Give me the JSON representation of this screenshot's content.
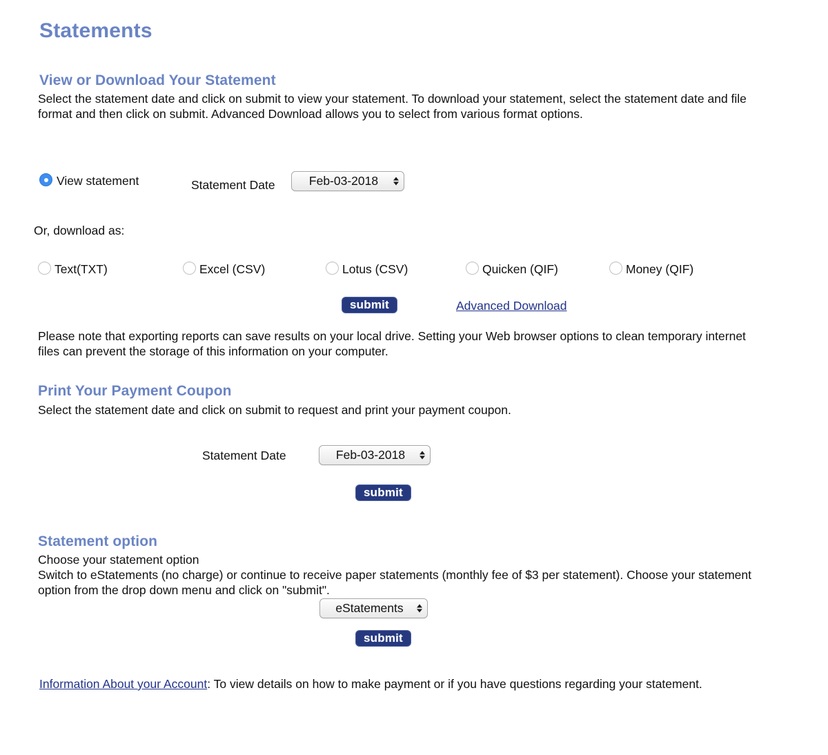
{
  "page": {
    "title": "Statements"
  },
  "view_download": {
    "heading": "View or Download Your Statement",
    "description": "Select the statement date and click on submit to view your statement. To download your statement, select the statement date and file format and then click on submit. Advanced Download allows you to select from various format options.",
    "view_statement_radio_label": "View statement",
    "statement_date_label": "Statement Date",
    "statement_date_value": "Feb-03-2018",
    "download_as_label": "Or, download as:",
    "download_formats": [
      {
        "label": "Text(TXT)",
        "checked": false
      },
      {
        "label": "Excel (CSV)",
        "checked": false
      },
      {
        "label": "Lotus (CSV)",
        "checked": false
      },
      {
        "label": "Quicken (QIF)",
        "checked": false
      },
      {
        "label": "Money (QIF)",
        "checked": false
      }
    ],
    "submit_label": "submit",
    "advanced_download_label": "Advanced Download",
    "export_note": "Please note that exporting reports can save results on your local drive. Setting your Web browser options to clean temporary internet files can prevent the storage of this information on your computer."
  },
  "payment_coupon": {
    "heading": "Print Your Payment Coupon",
    "description": "Select the statement date and click on submit to request and print your payment coupon.",
    "statement_date_label": "Statement Date",
    "statement_date_value": "Feb-03-2018",
    "submit_label": "submit"
  },
  "statement_option": {
    "heading": "Statement option",
    "line1": "Choose your statement option",
    "line2": "Switch to eStatements (no charge) or continue to receive paper statements (monthly fee of $3 per statement). Choose your statement option from the drop down menu and click on \"submit\".",
    "option_value": "eStatements",
    "submit_label": "submit"
  },
  "footer": {
    "link_label": "Information About your Account",
    "text": ": To view details on how to make payment or if you have questions regarding your statement."
  },
  "colors": {
    "heading_blue": "#6a84c4",
    "link_blue": "#22348a",
    "submit_navy": "#26397f",
    "radio_selected_blue": "#3e8ef0"
  }
}
